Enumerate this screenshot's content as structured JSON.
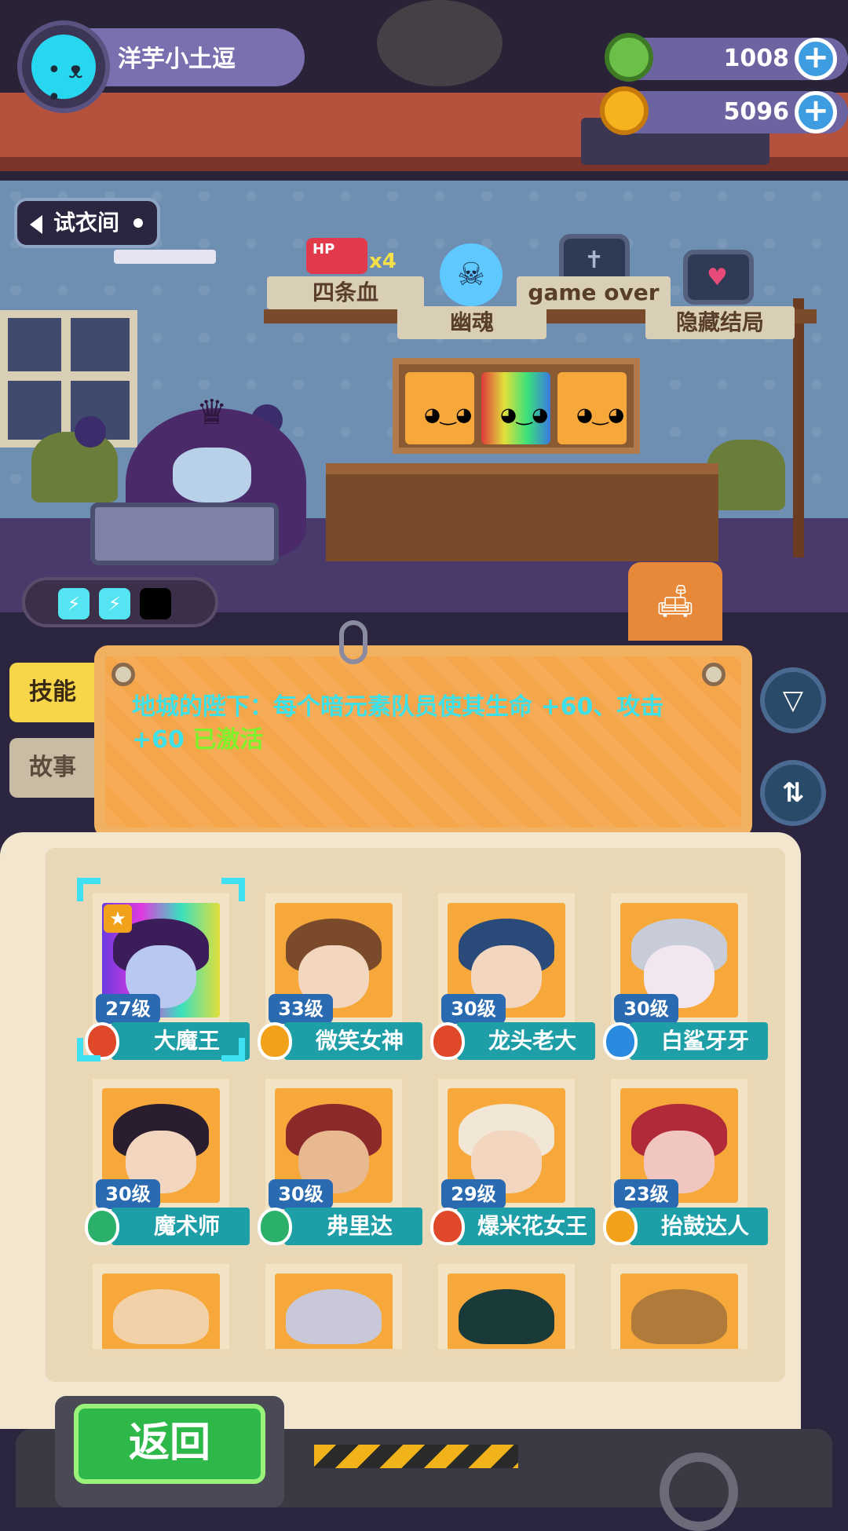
{
  "player": {
    "name": "洋芋小土逗"
  },
  "resources": {
    "gems": "1008",
    "coins": "5096",
    "plus": "+"
  },
  "buttons": {
    "fitting_room": "试衣间",
    "back": "返回",
    "filter_icon": "filter-icon",
    "sort_icon": "sort-icon"
  },
  "achievements": {
    "hp_badge": "HP",
    "hp_multiplier": "x4",
    "items": [
      "四条血",
      "幽魂",
      "game over",
      "隐藏结局"
    ]
  },
  "side_tabs": {
    "skill": "技能",
    "story": "故事"
  },
  "skill": {
    "text": "地城的陛下：每个暗元素队员使其生命 +60、攻击 +60 ",
    "status": "已激活"
  },
  "colors": {
    "accent_cyan": "#3ee0e8",
    "active_green": "#7ef22a",
    "panel_orange": "#f5a54a",
    "name_bar": "#1e9ea6",
    "back_green": "#2fb84a"
  },
  "characters": [
    {
      "name": "大魔王",
      "level": "27级",
      "class_color": "red",
      "selected": true
    },
    {
      "name": "微笑女神",
      "level": "33级",
      "class_color": "gold",
      "selected": false
    },
    {
      "name": "龙头老大",
      "level": "30级",
      "class_color": "red",
      "selected": false
    },
    {
      "name": "白鲨牙牙",
      "level": "30级",
      "class_color": "blue",
      "selected": false
    },
    {
      "name": "魔术师",
      "level": "30级",
      "class_color": "green",
      "selected": false
    },
    {
      "name": "弗里达",
      "level": "30级",
      "class_color": "green",
      "selected": false
    },
    {
      "name": "爆米花女王",
      "level": "29级",
      "class_color": "red",
      "selected": false
    },
    {
      "name": "抬鼓达人",
      "level": "23级",
      "class_color": "gold",
      "selected": false
    }
  ]
}
